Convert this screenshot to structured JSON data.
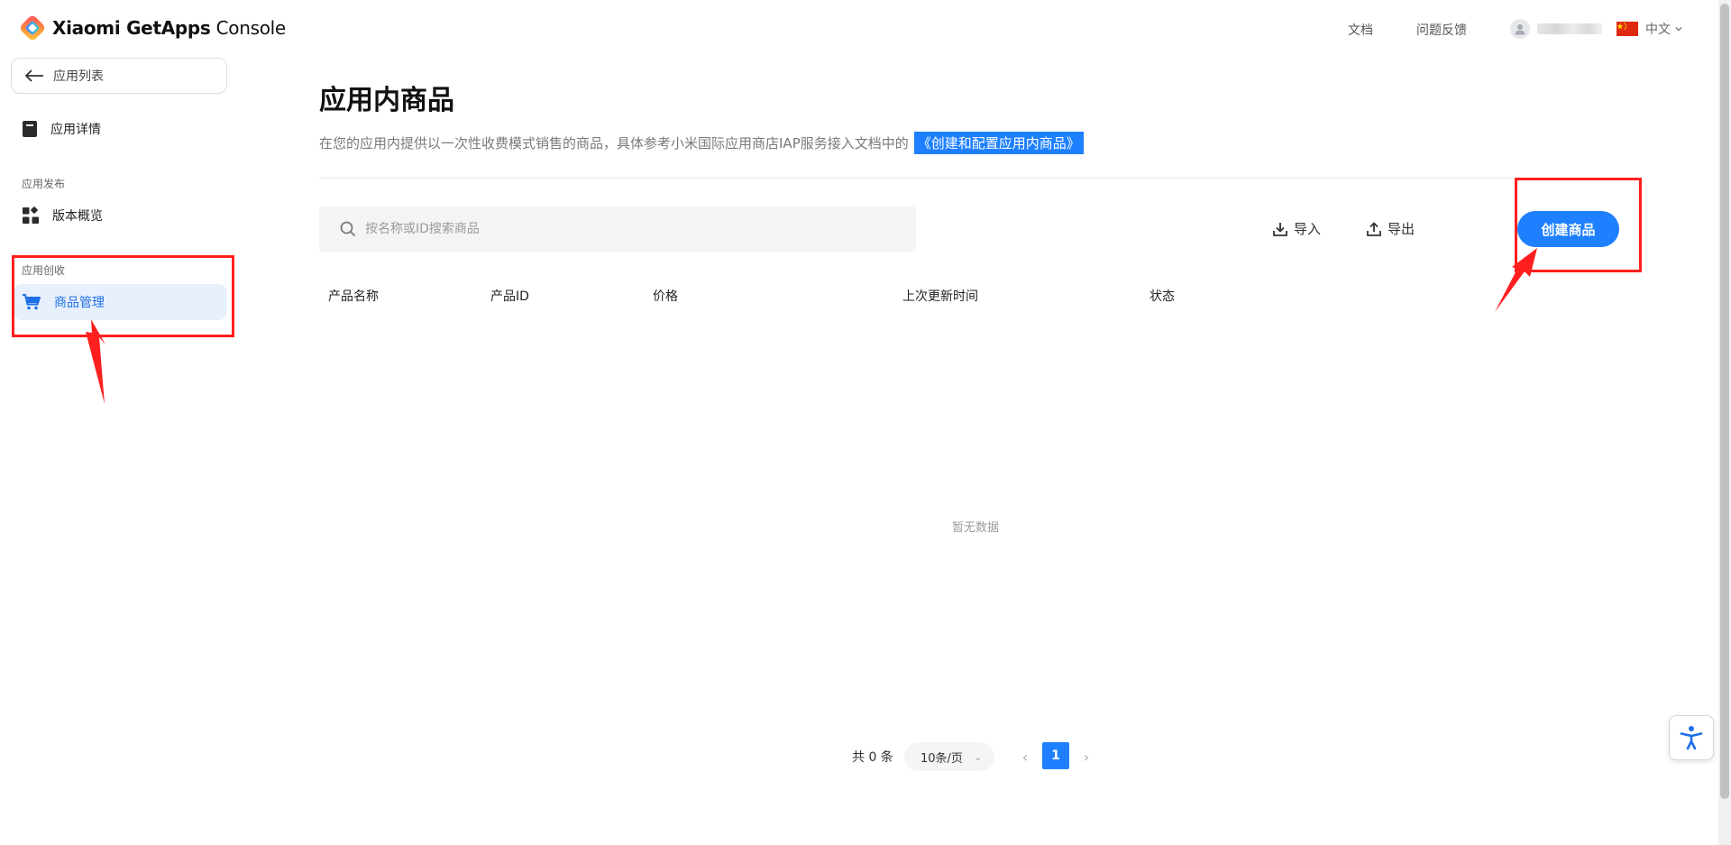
{
  "header": {
    "app_title_bold": "Xiaomi GetApps",
    "app_title_rest": "Console",
    "links": {
      "docs": "文档",
      "feedback": "问题反馈"
    },
    "language": "中文"
  },
  "sidebar": {
    "back_label": "应用列表",
    "items": {
      "app_details": "应用详情",
      "version_overview": "版本概览",
      "product_management": "商品管理"
    },
    "sections": {
      "publish": "应用发布",
      "monetize": "应用创收"
    }
  },
  "main": {
    "title": "应用内商品",
    "description": "在您的应用内提供以一次性收费模式销售的商品，具体参考小米国际应用商店IAP服务接入文档中的",
    "doc_link": "《创建和配置应用内商品》",
    "search": {
      "placeholder": "按名称或ID搜索商品"
    },
    "toolbar": {
      "import": "导入",
      "export": "导出",
      "create": "创建商品"
    },
    "table": {
      "columns": [
        "产品名称",
        "产品ID",
        "价格",
        "上次更新时间",
        "状态"
      ],
      "rows": [],
      "empty_text": "暂无数据"
    },
    "pagination": {
      "total_text": "共 0 条",
      "page_size": "10条/页",
      "current_page": "1"
    }
  },
  "colors": {
    "accent": "#1e80ff",
    "active_bg": "#e8f0fd",
    "annotation_red": "#ff1f1f"
  },
  "icons": [
    "app-logo-icon",
    "user-avatar-icon",
    "china-flag-icon",
    "chevron-down-icon",
    "arrow-left-icon",
    "document-icon",
    "grid-icon",
    "cart-icon",
    "search-icon",
    "download-icon",
    "upload-icon",
    "chevron-left-icon",
    "chevron-right-icon",
    "accessibility-icon"
  ]
}
